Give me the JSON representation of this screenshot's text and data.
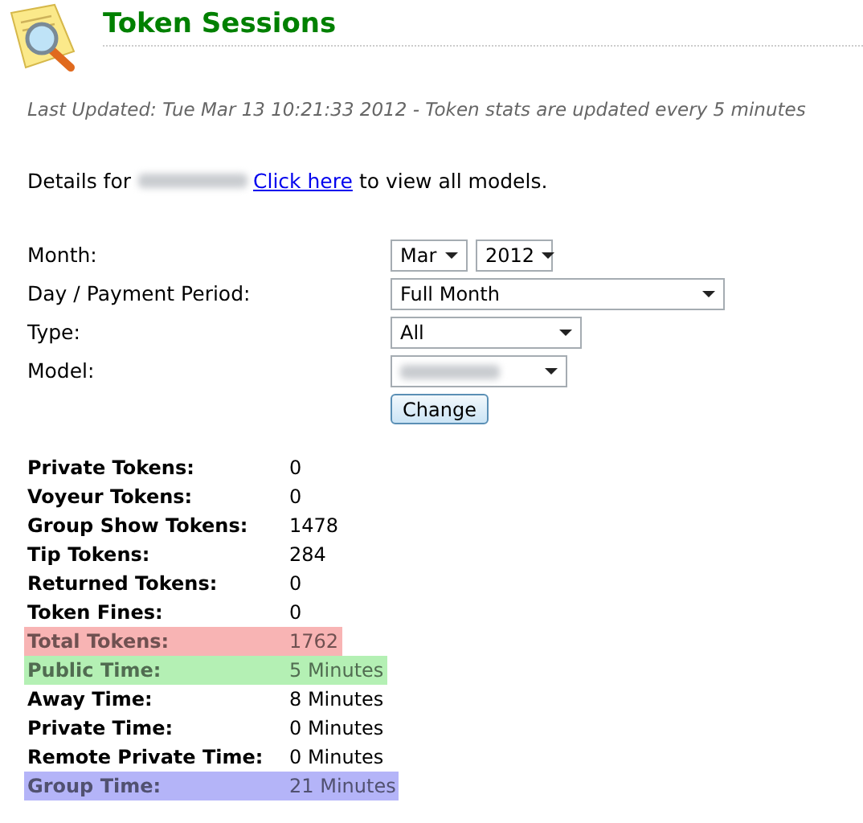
{
  "header": {
    "title": "Token Sessions"
  },
  "last_updated": "Last Updated: Tue Mar 13 10:21:33 2012 - Token stats are updated every 5 minutes",
  "details": {
    "prefix": "Details for",
    "link": "Click here",
    "suffix": "to view all models."
  },
  "form": {
    "fields": [
      {
        "label": "Month:",
        "selects": [
          {
            "value": "Mar",
            "kind": "short"
          },
          {
            "value": "2012",
            "kind": "short"
          }
        ]
      },
      {
        "label": "Day / Payment Period:",
        "selects": [
          {
            "value": "Full Month",
            "kind": "wide"
          }
        ]
      },
      {
        "label": "Type:",
        "selects": [
          {
            "value": "All",
            "kind": "medium"
          }
        ]
      },
      {
        "label": "Model:",
        "selects": [
          {
            "kind": "blurred"
          }
        ]
      }
    ],
    "button": "Change"
  },
  "stats": [
    {
      "label": "Private Tokens:",
      "value": "0"
    },
    {
      "label": "Voyeur Tokens:",
      "value": "0"
    },
    {
      "label": "Group Show Tokens:",
      "value": "1478"
    },
    {
      "label": "Tip Tokens:",
      "value": "284"
    },
    {
      "label": "Returned Tokens:",
      "value": "0"
    },
    {
      "label": "Token Fines:",
      "value": "0"
    },
    {
      "label": "Total Tokens:",
      "value": "1762",
      "color": "#f8b4b4"
    },
    {
      "label": "Public Time:",
      "value": "5 Minutes",
      "color": "#b4f0b4"
    },
    {
      "label": "Away Time:",
      "value": "8 Minutes"
    },
    {
      "label": "Private Time:",
      "value": "0 Minutes"
    },
    {
      "label": "Remote Private Time:",
      "value": "0 Minutes"
    },
    {
      "label": "Group Time:",
      "value": "21 Minutes",
      "color": "#b4b4f8"
    }
  ]
}
